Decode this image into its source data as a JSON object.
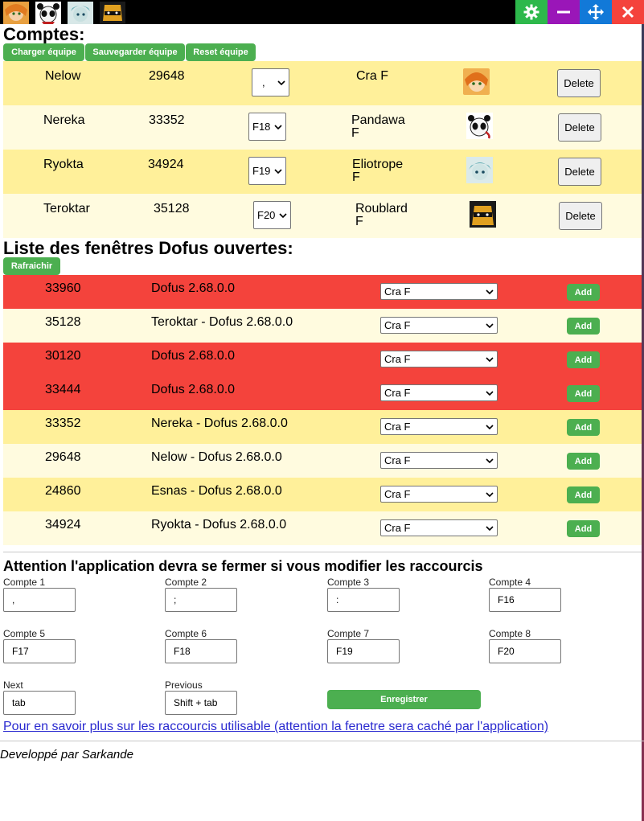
{
  "topbar": {
    "avatars": [
      {
        "name": "avatar-cra"
      },
      {
        "name": "avatar-pandawa"
      },
      {
        "name": "avatar-eliotrope"
      },
      {
        "name": "avatar-roublard"
      }
    ],
    "controls": [
      "gear-icon",
      "minimize-icon",
      "move-icon",
      "close-icon"
    ],
    "colors": {
      "gear": "#2db84b",
      "min": "#9a16b8",
      "move": "#1279d8",
      "close": "#f4433c"
    }
  },
  "comptes": {
    "title": "Comptes:",
    "buttons": {
      "load": "Charger équipe",
      "save": "Sauvegarder équipe",
      "reset": "Reset équipe"
    },
    "rows": [
      {
        "name": "Nelow",
        "pid": "29648",
        "shortcut": ",",
        "class_line1": "Cra F",
        "class_line2": "",
        "avatar": "cra",
        "delete": "Delete"
      },
      {
        "name": "Nereka",
        "pid": "33352",
        "shortcut": "F18",
        "class_line1": "Pandawa",
        "class_line2": "F",
        "avatar": "pandawa",
        "delete": "Delete"
      },
      {
        "name": "Ryokta",
        "pid": "34924",
        "shortcut": "F19",
        "class_line1": "Eliotrope",
        "class_line2": "F",
        "avatar": "eliotrope",
        "delete": "Delete"
      },
      {
        "name": "Teroktar",
        "pid": "35128",
        "shortcut": "F20",
        "class_line1": "Roublard",
        "class_line2": "F",
        "avatar": "roublard",
        "delete": "Delete"
      }
    ]
  },
  "windows": {
    "title": "Liste des fenêtres Dofus ouvertes:",
    "refresh": "Rafraichir",
    "rows": [
      {
        "pid": "33960",
        "title": "Dofus 2.68.0.0",
        "class": "Cra F",
        "add": "Add",
        "color": "#f4433c"
      },
      {
        "pid": "35128",
        "title": "Teroktar - Dofus 2.68.0.0",
        "class": "Cra F",
        "add": "Add",
        "color": "#fffbdf"
      },
      {
        "pid": "30120",
        "title": "Dofus 2.68.0.0",
        "class": "Cra F",
        "add": "Add",
        "color": "#f4433c"
      },
      {
        "pid": "33444",
        "title": "Dofus 2.68.0.0",
        "class": "Cra F",
        "add": "Add",
        "color": "#f4433c"
      },
      {
        "pid": "33352",
        "title": "Nereka - Dofus 2.68.0.0",
        "class": "Cra F",
        "add": "Add",
        "color": "#fff09a"
      },
      {
        "pid": "29648",
        "title": "Nelow - Dofus 2.68.0.0",
        "class": "Cra F",
        "add": "Add",
        "color": "#fffbdf"
      },
      {
        "pid": "24860",
        "title": "Esnas - Dofus 2.68.0.0",
        "class": "Cra F",
        "add": "Add",
        "color": "#fff09a"
      },
      {
        "pid": "34924",
        "title": "Ryokta - Dofus 2.68.0.0",
        "class": "Cra F",
        "add": "Add",
        "color": "#fffbdf"
      }
    ]
  },
  "shortcuts": {
    "warning": "Attention l'application devra se fermer si vous modifier les raccourcis",
    "fields": [
      {
        "label": "Compte 1",
        "value": ","
      },
      {
        "label": "Compte 2",
        "value": ";"
      },
      {
        "label": "Compte 3",
        "value": ":"
      },
      {
        "label": "Compte 4",
        "value": "F16"
      },
      {
        "label": "Compte 5",
        "value": "F17"
      },
      {
        "label": "Compte 6",
        "value": "F18"
      },
      {
        "label": "Compte 7",
        "value": "F19"
      },
      {
        "label": "Compte 8",
        "value": "F20"
      },
      {
        "label": "Next",
        "value": "tab"
      },
      {
        "label": "Previous",
        "value": "Shift + tab"
      }
    ],
    "save": "Enregistrer",
    "link": "Pour en savoir plus sur les raccourcis utilisable (attention la fenetre sera caché par l'application)"
  },
  "footer": "Developpé par Sarkande"
}
